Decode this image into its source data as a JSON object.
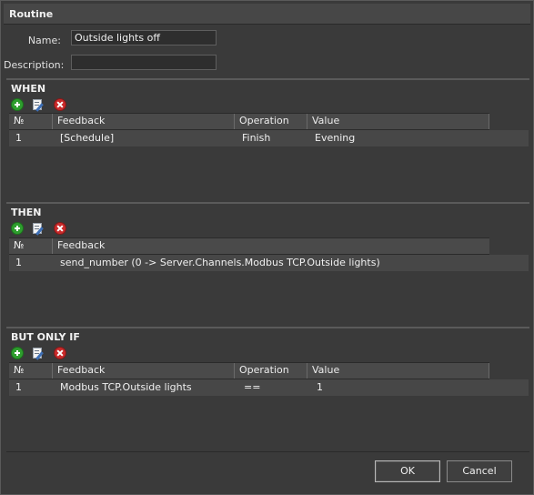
{
  "window": {
    "title": "Routine"
  },
  "form": {
    "name_label": "Name:",
    "name_value": "Outside lights off",
    "description_label": "Description:",
    "description_value": ""
  },
  "when": {
    "title": "WHEN",
    "columns": [
      "№",
      "Feedback",
      "Operation",
      "Value"
    ],
    "rows": [
      {
        "no": "1",
        "feedback": "[Schedule]",
        "operation": "Finish",
        "value": "Evening"
      }
    ]
  },
  "then": {
    "title": "THEN",
    "columns": [
      "№",
      "Feedback"
    ],
    "rows": [
      {
        "no": "1",
        "feedback": "send_number (0 -> Server.Channels.Modbus TCP.Outside lights)"
      }
    ]
  },
  "but_only_if": {
    "title": "BUT ONLY IF",
    "columns": [
      "№",
      "Feedback",
      "Operation",
      "Value"
    ],
    "rows": [
      {
        "no": "1",
        "feedback": "Modbus TCP.Outside lights",
        "operation": "==",
        "value": "1"
      }
    ]
  },
  "toolbar_icons": [
    "add-icon",
    "edit-icon",
    "delete-icon"
  ],
  "colors": {
    "add": "#2e9e2e",
    "delete": "#c92a2a",
    "panel": "#3a3a3a"
  },
  "buttons": {
    "ok": "OK",
    "cancel": "Cancel"
  }
}
